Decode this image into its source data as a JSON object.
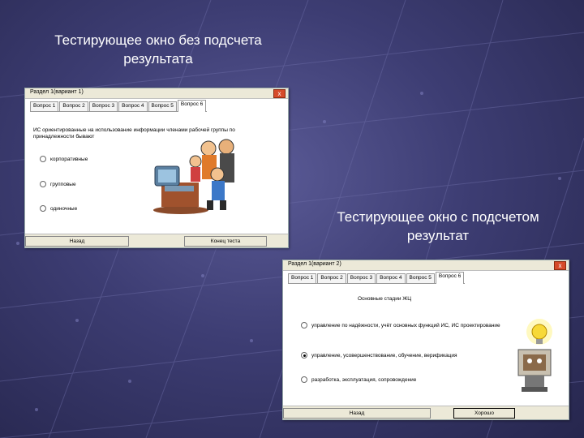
{
  "caption_left": "Тестирующее окно без подсчета результата",
  "caption_right": "Тестирующее окно с подсчетом результат",
  "window1": {
    "title": "Раздел 1(вариант 1)",
    "close_label": "x",
    "tabs": [
      "Вопрос 1",
      "Вопрос 2",
      "Вопрос 3",
      "Вопрос 4",
      "Вопрос 5",
      "Вопрос 6"
    ],
    "question": "ИС ориентированные на использование информации членами рабочей группы по принадлежности бывают",
    "options": [
      "корпоративные",
      "групповые",
      "одиночные"
    ],
    "back_button": "Назад",
    "finish_button": "Конец теста"
  },
  "window2": {
    "title": "Раздел 1(вариант 2)",
    "close_label": "x",
    "tabs": [
      "Вопрос 1",
      "Вопрос 2",
      "Вопрос 3",
      "Вопрос 4",
      "Вопрос 5",
      "Вопрос 6"
    ],
    "question": "Основные стадии ЖЦ",
    "options": [
      "управление по надёжности, учёт основных функций ИС, ИС проектирование",
      "управление, усовершенствование, обучение, верификация",
      "разработка, эксплуатация, сопровождение"
    ],
    "selected_option": 1,
    "back_button": "Назад",
    "ok_button": "Хорошо"
  }
}
